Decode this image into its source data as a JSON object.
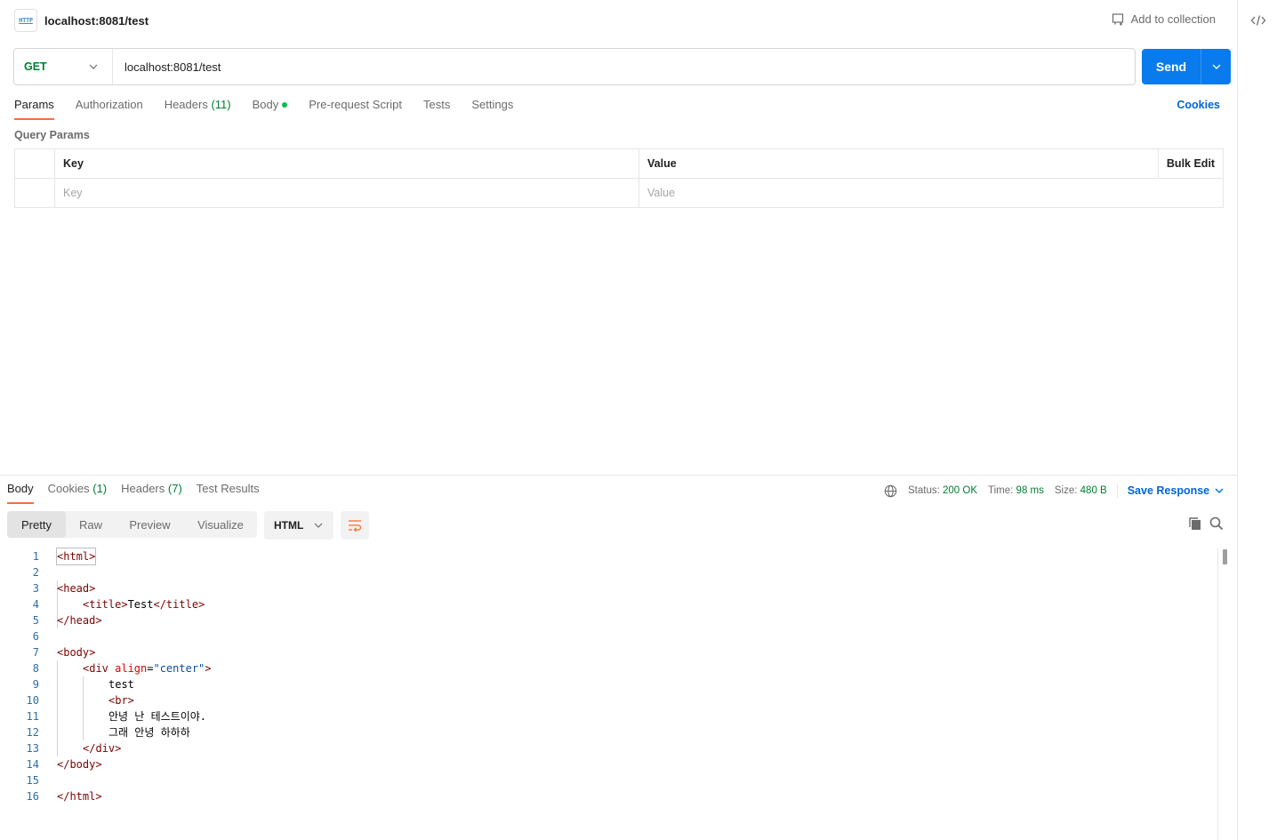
{
  "tab": {
    "title": "localhost:8081/test",
    "badge": "HTTP"
  },
  "header": {
    "add_to_collection": "Add to collection"
  },
  "request": {
    "method": "GET",
    "url": "localhost:8081/test",
    "send_label": "Send"
  },
  "request_tabs": [
    {
      "label": "Params",
      "active": true
    },
    {
      "label": "Authorization"
    },
    {
      "label": "Headers",
      "count": "(11)"
    },
    {
      "label": "Body"
    },
    {
      "label": "Pre-request Script"
    },
    {
      "label": "Tests"
    },
    {
      "label": "Settings"
    }
  ],
  "cookies_link": "Cookies",
  "query_params": {
    "title": "Query Params",
    "headers": {
      "key": "Key",
      "value": "Value",
      "bulk_edit": "Bulk Edit"
    },
    "placeholders": {
      "key": "Key",
      "value": "Value"
    }
  },
  "response": {
    "tabs": [
      {
        "label": "Body",
        "active": true
      },
      {
        "label": "Cookies",
        "count": "(1)"
      },
      {
        "label": "Headers",
        "count": "(7)"
      },
      {
        "label": "Test Results"
      }
    ],
    "status_label": "Status:",
    "status_value": "200 OK",
    "time_label": "Time:",
    "time_value": "98 ms",
    "size_label": "Size:",
    "size_value": "480 B",
    "save_response": "Save Response",
    "views": [
      "Pretty",
      "Raw",
      "Preview",
      "Visualize"
    ],
    "language": "HTML",
    "code_lines": [
      {
        "n": "1"
      },
      {
        "n": "2"
      },
      {
        "n": "3"
      },
      {
        "n": "4"
      },
      {
        "n": "5"
      },
      {
        "n": "6"
      },
      {
        "n": "7"
      },
      {
        "n": "8"
      },
      {
        "n": "9"
      },
      {
        "n": "10"
      },
      {
        "n": "11"
      },
      {
        "n": "12"
      },
      {
        "n": "13"
      },
      {
        "n": "14"
      },
      {
        "n": "15"
      },
      {
        "n": "16"
      }
    ],
    "code": {
      "l1": "<html>",
      "l3": "<head>",
      "l4_open": "<title>",
      "l4_text": "Test",
      "l4_close": "</title>",
      "l5": "</head>",
      "l7": "<body>",
      "l8_open": "<div ",
      "l8_attr": "align",
      "l8_eq": "=",
      "l8_val": "\"center\"",
      "l8_end": ">",
      "l9": "test",
      "l10": "<br>",
      "l11": "안녕 난 테스트이야.",
      "l12": "그래 안녕 하하하",
      "l13": "</div>",
      "l14": "</body>",
      "l16": "</html>"
    }
  },
  "colors": {
    "accent_orange": "#ff6c37",
    "send_blue": "#097bed",
    "link_blue": "#0265d2",
    "method_green": "#007f31"
  }
}
